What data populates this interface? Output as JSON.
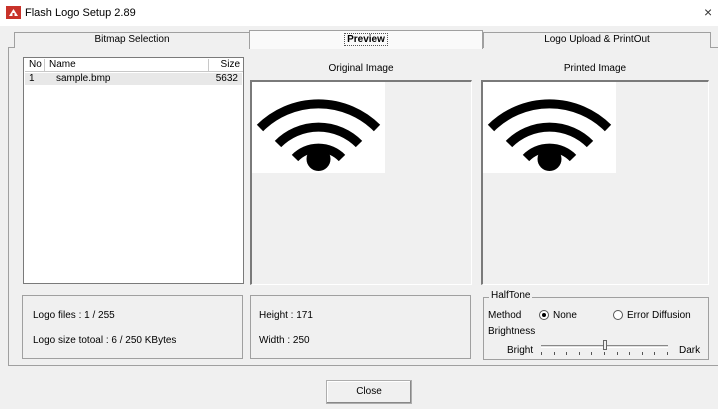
{
  "window": {
    "title": "Flash Logo Setup 2.89",
    "close_glyph": "×",
    "icon": "app-logo-icon"
  },
  "tabs": [
    {
      "label": "Bitmap Selection",
      "selected": false
    },
    {
      "label": "Preview",
      "selected": true
    },
    {
      "label": "Logo Upload & PrintOut",
      "selected": false
    }
  ],
  "file_list": {
    "columns": [
      "No",
      "Name",
      "Size"
    ],
    "rows": [
      {
        "no": "1",
        "name": "sample.bmp",
        "size": "5632"
      }
    ]
  },
  "preview": {
    "original_caption": "Original Image",
    "printed_caption": "Printed Image",
    "image_icon": "wifi-icon"
  },
  "info": {
    "logo_files": "Logo files : 1 / 255",
    "logo_size": "Logo size totoal : 6 / 250 KBytes",
    "height": "Height : 171",
    "width": "Width : 250"
  },
  "halftone": {
    "group_label": "HalfTone",
    "method_label": "Method",
    "options": [
      "None",
      "Error Diffusion"
    ],
    "selected_option": "None",
    "brightness_label": "Brightness",
    "bright_label": "Bright",
    "dark_label": "Dark",
    "brightness_level": 0.5
  },
  "buttons": {
    "close_label": "Close"
  }
}
